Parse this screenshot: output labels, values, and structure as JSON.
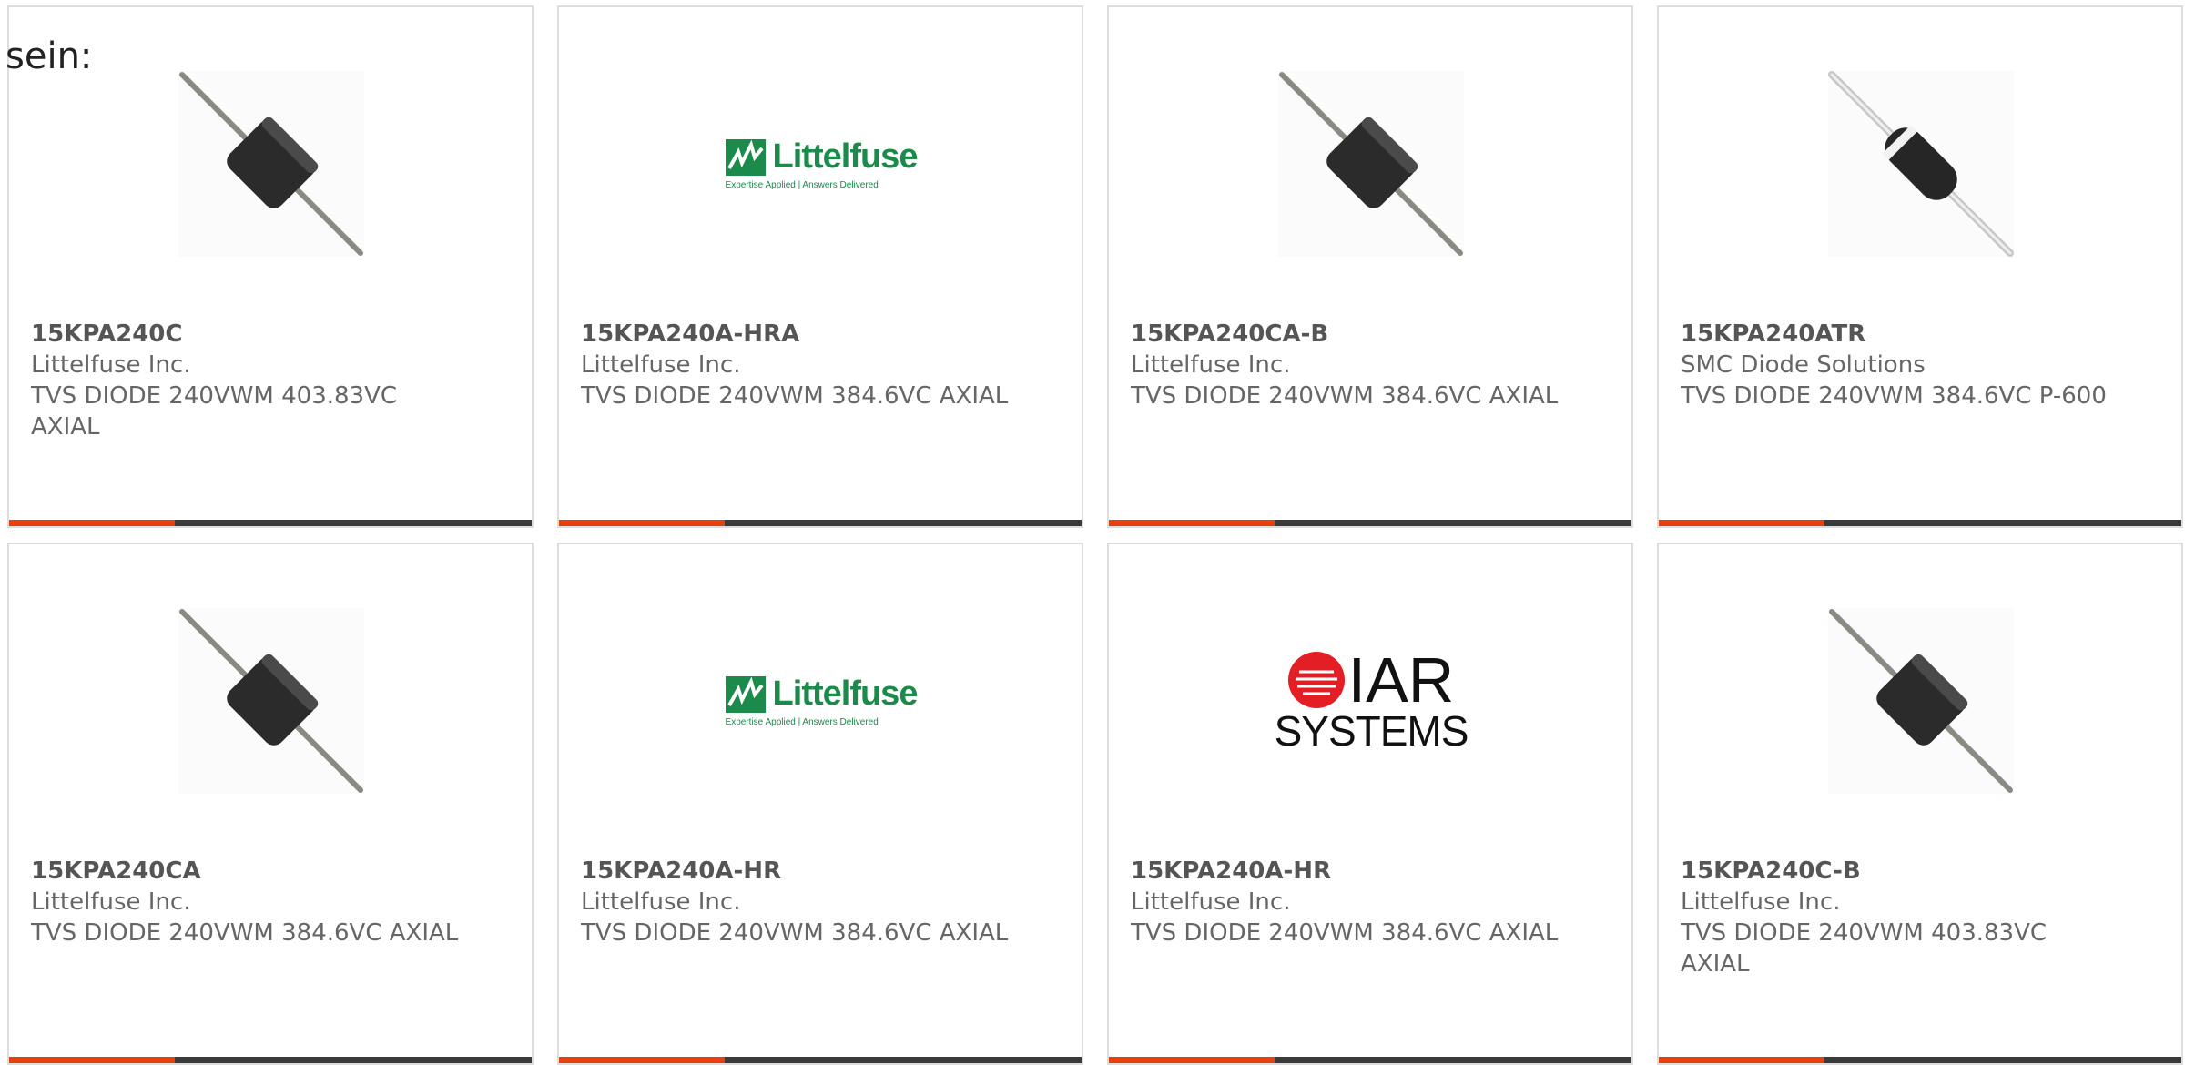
{
  "intro_text": "sein:",
  "cards": [
    {
      "part_number": "15KPA240C",
      "manufacturer": "Littelfuse Inc.",
      "description": "TVS DIODE 240VWM 403.83VC AXIAL",
      "image": "axial-diode-photo"
    },
    {
      "part_number": "15KPA240A-HRA",
      "manufacturer": "Littelfuse Inc.",
      "description": "TVS DIODE 240VWM 384.6VC AXIAL",
      "image": "littelfuse-logo",
      "logo_word": "Littelfuse",
      "logo_tag": "Expertise Applied | Answers Delivered"
    },
    {
      "part_number": "15KPA240CA-B",
      "manufacturer": "Littelfuse Inc.",
      "description": "TVS DIODE 240VWM 384.6VC AXIAL",
      "image": "axial-diode-photo"
    },
    {
      "part_number": "15KPA240ATR",
      "manufacturer": "SMC Diode Solutions",
      "description": "TVS DIODE 240VWM 384.6VC P-600",
      "image": "axial-diode-banded-photo"
    },
    {
      "part_number": "15KPA240CA",
      "manufacturer": "Littelfuse Inc.",
      "description": "TVS DIODE 240VWM 384.6VC AXIAL",
      "image": "axial-diode-photo"
    },
    {
      "part_number": "15KPA240A-HR",
      "manufacturer": "Littelfuse Inc.",
      "description": "TVS DIODE 240VWM 384.6VC AXIAL",
      "image": "littelfuse-logo",
      "logo_word": "Littelfuse",
      "logo_tag": "Expertise Applied | Answers Delivered"
    },
    {
      "part_number": "15KPA240A-HR",
      "manufacturer": "Littelfuse Inc.",
      "description": "TVS DIODE 240VWM 384.6VC AXIAL",
      "image": "iar-systems-logo",
      "logo_word": "IAR",
      "logo_tag": "SYSTEMS"
    },
    {
      "part_number": "15KPA240C-B",
      "manufacturer": "Littelfuse Inc.",
      "description": "TVS DIODE 240VWM 403.83VC AXIAL",
      "image": "axial-diode-photo"
    }
  ],
  "colors": {
    "accent": "#e8400c",
    "bar": "#3a3a3a",
    "border": "#dddddd",
    "text": "#666666",
    "littelfuse_green": "#1b8a4a",
    "iar_red": "#e31e24"
  }
}
